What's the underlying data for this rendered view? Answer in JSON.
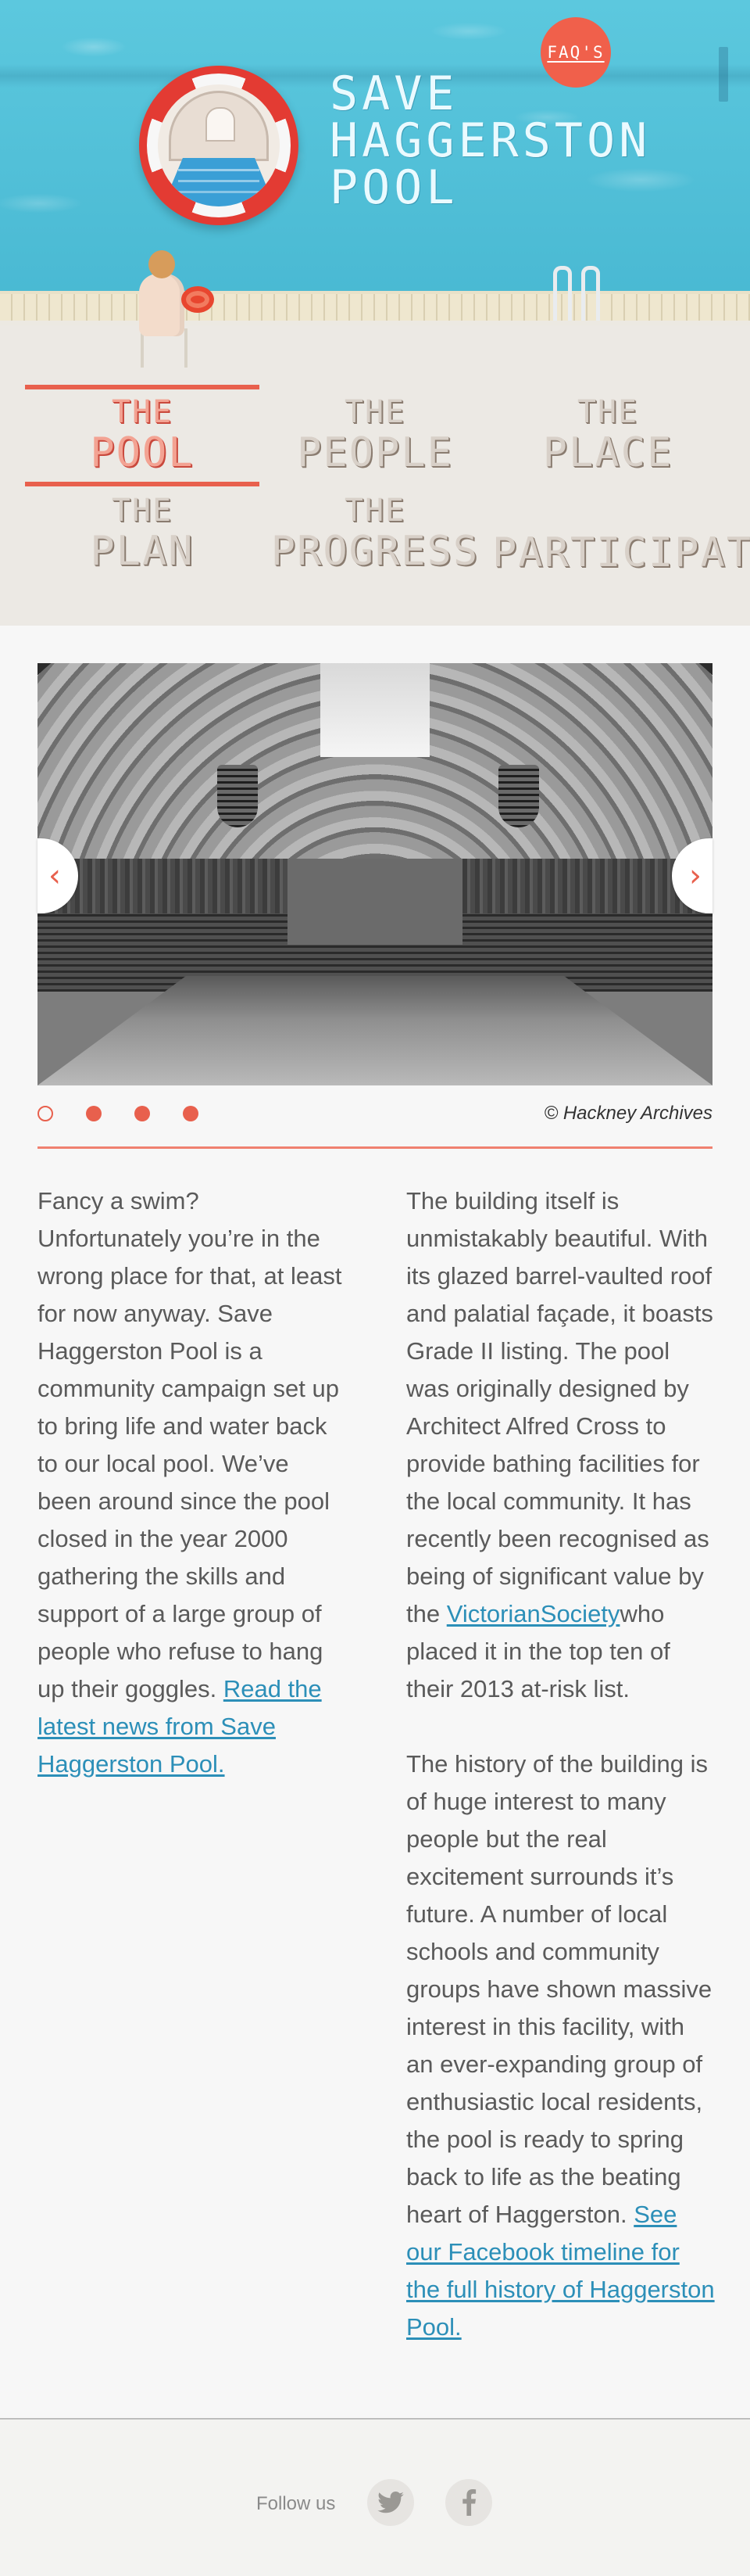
{
  "header": {
    "faq_label": "FAQ'S",
    "title_lines": [
      "SAVE",
      "HAGGERSTON",
      "POOL"
    ]
  },
  "nav": {
    "items": [
      {
        "small": "THE",
        "big": "POOL",
        "active": true
      },
      {
        "small": "THE",
        "big": "PEOPLE",
        "active": false
      },
      {
        "small": "THE",
        "big": "PLACE",
        "active": false
      },
      {
        "small": "THE",
        "big": "PLAN",
        "active": false
      },
      {
        "small": "THE",
        "big": "PROGRESS",
        "active": false
      },
      {
        "small": "",
        "big": "PARTICIPATE",
        "active": false
      }
    ]
  },
  "slider": {
    "prev_glyph": "‹",
    "next_glyph": "›",
    "slide_count": 4,
    "active_index": 0,
    "credit": "© Hackney Archives"
  },
  "content": {
    "left": {
      "text": "Fancy a swim? Unfortunately you’re in the wrong place for that, at least for now anyway. Save Haggerston Pool is a community campaign set up to bring life and water back to our local pool. We’ve been around since the pool closed in the year 2000 gathering the skills and support of a large group of people who refuse to hang up their goggles. ",
      "link": "Read the latest news from Save Haggerston Pool."
    },
    "right": {
      "p1_text": "The building itself is unmistakably beautiful. With its glazed barrel-vaulted roof and palatial façade, it boasts Grade II listing. The pool was originally designed by Architect Alfred Cross to provide bathing facilities for the local community. It has recently been recognised as being of significant value by the ",
      "p1_link": "VictorianSociety",
      "p1_tail": "who placed it in the top ten of their 2013 at-risk list.",
      "p2_text": "The history of the building is of huge interest to many people but the real excitement surrounds it’s future. A number of local schools and community groups have shown massive interest in this facility, with an ever-expanding group of enthusiastic local residents, the pool is ready to spring back to life as the beating heart of Haggerston. ",
      "p2_link": "See our Facebook timeline for the full history of Haggerston Pool."
    }
  },
  "footer": {
    "follow_label": "Follow us",
    "icons": [
      "twitter-icon",
      "facebook-icon"
    ]
  },
  "colors": {
    "accent": "#e8604d",
    "pool": "#4fc1d8",
    "link": "#2c8fb8"
  }
}
